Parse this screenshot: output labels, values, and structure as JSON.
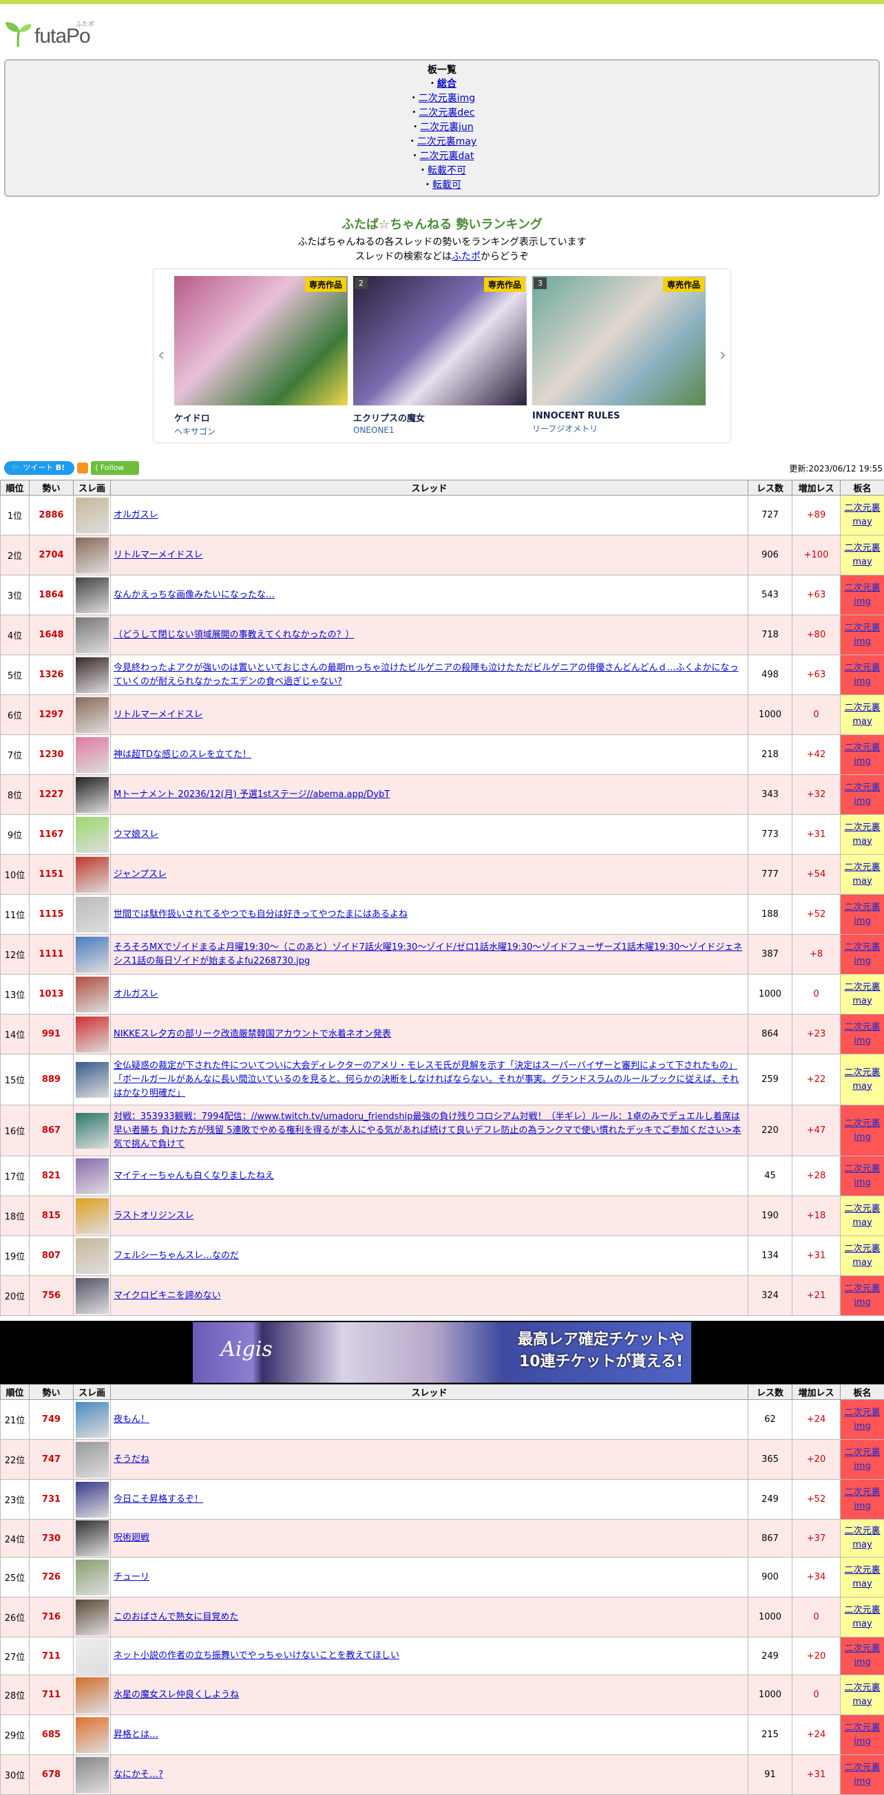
{
  "logo": {
    "text": "futaPo",
    "kana": "ふたポ"
  },
  "boards": {
    "title": "板一覧",
    "items": [
      {
        "label": "総合",
        "bold": true
      },
      {
        "label": "二次元裏img"
      },
      {
        "label": "二次元裏dec"
      },
      {
        "label": "二次元裏jun"
      },
      {
        "label": "二次元裏may"
      },
      {
        "label": "二次元裏dat"
      },
      {
        "label": "転載不可"
      },
      {
        "label": "転載可"
      }
    ]
  },
  "ranking": {
    "title": "ふたば☆ちゃんねる 勢いランキング",
    "desc1": "ふたばちゃんねるの各スレッドの勢いをランキング表示しています",
    "desc2_pre": "スレッドの検索などは",
    "desc2_link": "ふたポ",
    "desc2_post": "からどうぞ"
  },
  "carousel": {
    "items": [
      {
        "name": "ケイドロ",
        "maker": "ヘキサゴン",
        "badge": "専売作品",
        "num": "",
        "c1": "#b85c88",
        "c2": "#3b7a3a"
      },
      {
        "name": "エクリプスの魔女",
        "maker": "ONEONE1",
        "badge": "専売作品",
        "num": "2",
        "c1": "#2a1f3a",
        "c2": "#7a6cb0"
      },
      {
        "name": "INNOCENT RULES",
        "maker": "リーフジオメトリ",
        "badge": "専売作品",
        "num": "3",
        "c1": "#6aa89a",
        "c2": "#e0d7cf"
      }
    ]
  },
  "social": {
    "tweet": "ツイート",
    "hatena": "B!",
    "follow": "Follow"
  },
  "updated": "更新:2023/06/12 19:55",
  "table": {
    "headers": {
      "rank": "順位",
      "ikioi": "勢い",
      "thumb": "スレ画",
      "thread": "スレッド",
      "res": "レス数",
      "inc": "増加レス",
      "board": "板名"
    }
  },
  "rows1": [
    {
      "rank": "1位",
      "ikioi": "2886",
      "title": "オルガスレ",
      "res": "727",
      "inc": "+89",
      "board": "二次元裏may",
      "type": "may",
      "h": 58,
      "c": "#c8b89a"
    },
    {
      "rank": "2位",
      "ikioi": "2704",
      "title": "リトルマーメイドスレ",
      "res": "906",
      "inc": "+100",
      "board": "二次元裏may",
      "type": "may",
      "h": 58,
      "c": "#8a6a5a"
    },
    {
      "rank": "3位",
      "ikioi": "1864",
      "title": "なんかえっちな画像みたいになったな…",
      "res": "543",
      "inc": "+63",
      "board": "二次元裏img",
      "type": "img",
      "h": 58,
      "c": "#444"
    },
    {
      "rank": "4位",
      "ikioi": "1648",
      "title": "（どうして閉じない領域展開の事教えてくれなかったの？）",
      "res": "718",
      "inc": "+80",
      "board": "二次元裏img",
      "type": "img",
      "h": 58,
      "c": "#777"
    },
    {
      "rank": "5位",
      "ikioi": "1326",
      "title": "今見終わったよアクが強いのは置いといておじさんの最期mっちゃ泣けたビルゲニアの殺陣も泣けたただビルゲニアの俳優さんどんどんｄ…ふくよかになっていくのが耐えられなかったエデンの食べ過ぎじゃない?",
      "res": "498",
      "inc": "+63",
      "board": "二次元裏img",
      "type": "img",
      "h": 58,
      "c": "#3a2a2a"
    },
    {
      "rank": "6位",
      "ikioi": "1297",
      "title": "リトルマーメイドスレ",
      "res": "1000",
      "inc": "0",
      "board": "二次元裏may",
      "type": "may",
      "h": 58,
      "c": "#8a6a5a"
    },
    {
      "rank": "7位",
      "ikioi": "1230",
      "title": "神は超TDな感じのスレを立てた！",
      "res": "218",
      "inc": "+42",
      "board": "二次元裏img",
      "type": "img",
      "h": 58,
      "c": "#e07aa0"
    },
    {
      "rank": "8位",
      "ikioi": "1227",
      "title": "Mトーナメント 20236/12(月) 予選1stステージ//abema.app/DybT",
      "res": "343",
      "inc": "+32",
      "board": "二次元裏img",
      "type": "img",
      "h": 58,
      "c": "#222"
    },
    {
      "rank": "9位",
      "ikioi": "1167",
      "title": "ウマ娘スレ",
      "res": "773",
      "inc": "+31",
      "board": "二次元裏may",
      "type": "may",
      "h": 58,
      "c": "#9ad86a"
    },
    {
      "rank": "10位",
      "ikioi": "1151",
      "title": "ジャンプスレ",
      "res": "777",
      "inc": "+54",
      "board": "二次元裏may",
      "type": "may",
      "h": 58,
      "c": "#c0392b"
    },
    {
      "rank": "11位",
      "ikioi": "1115",
      "title": "世間では駄作扱いされてるやつでも自分は好きってやつたまにはあるよね",
      "res": "188",
      "inc": "+52",
      "board": "二次元裏img",
      "type": "img",
      "h": 58,
      "c": "#bbb"
    },
    {
      "rank": "12位",
      "ikioi": "1111",
      "title": "そろそろMXでゾイドまるよ月曜19:30～（このあと）ゾイド7話火曜19:30～ゾイド/ゼロ1話水曜19:30～ゾイドフューザーズ1話木曜19:30～ゾイドジェネシス1話の毎日ゾイドが始まるよfu2268730.jpg",
      "res": "387",
      "inc": "+8",
      "board": "二次元裏img",
      "type": "img",
      "h": 58,
      "c": "#4a7ac0"
    },
    {
      "rank": "13位",
      "ikioi": "1013",
      "title": "オルガスレ",
      "res": "1000",
      "inc": "0",
      "board": "二次元裏may",
      "type": "may",
      "h": 58,
      "c": "#b05040"
    },
    {
      "rank": "14位",
      "ikioi": "991",
      "title": "NIKKEスレ夕方の部リーク改造厳禁韓国アカウントで水着ネオン発表",
      "res": "864",
      "inc": "+23",
      "board": "二次元裏img",
      "type": "img",
      "h": 58,
      "c": "#d03030"
    },
    {
      "rank": "15位",
      "ikioi": "889",
      "title": "全仏疑惑の裁定が下された件についてついに大会ディレクターのアメリ・モレスモ氏が見解を示す「決定はスーパーバイザーと審判によって下されたもの」「ボールガールがあんなに長い間泣いているのを見ると、何らかの決断をしなければならない。それが事実。グランドスラムのルールブックに従えば、それはかなり明確だ」",
      "res": "259",
      "inc": "+22",
      "board": "二次元裏may",
      "type": "may",
      "h": 74,
      "c": "#3a5a8a"
    },
    {
      "rank": "16位",
      "ikioi": "867",
      "title": "対戦：353933観戦：7994配信：//www.twitch.tv/umadoru_friendship最強の負け残りコロシアム対戦！（半ギレ）ルール：1卓のみでデュエルし着席は早い者勝ち 負けた方が残留 5連敗でやめる権利を得るが本人にやる気があれば続けて良いデフレ防止の為ランクマで使い慣れたデッキでご参加ください>本気で挑んで負けて",
      "res": "220",
      "inc": "+47",
      "board": "二次元裏img",
      "type": "img",
      "h": 74,
      "c": "#2a7a6a"
    },
    {
      "rank": "17位",
      "ikioi": "821",
      "title": "マイティーちゃんも白くなりましたねえ",
      "res": "45",
      "inc": "+28",
      "board": "二次元裏img",
      "type": "img",
      "h": 58,
      "c": "#8a6ab0"
    },
    {
      "rank": "18位",
      "ikioi": "815",
      "title": "ラストオリジンスレ",
      "res": "190",
      "inc": "+18",
      "board": "二次元裏may",
      "type": "may",
      "h": 58,
      "c": "#e0a020"
    },
    {
      "rank": "19位",
      "ikioi": "807",
      "title": "フェルシーちゃんスレ…なのだ",
      "res": "134",
      "inc": "+31",
      "board": "二次元裏may",
      "type": "may",
      "h": 58,
      "c": "#c8b89a"
    },
    {
      "rank": "20位",
      "ikioi": "756",
      "title": "マイクロビキニを諦めない",
      "res": "324",
      "inc": "+21",
      "board": "二次元裏img",
      "type": "img",
      "h": 58,
      "c": "#556"
    }
  ],
  "ad": {
    "logo": "Aigis",
    "line1": "最高レア確定チケットや",
    "line2": "10連チケットが貰える!"
  },
  "rows2": [
    {
      "rank": "21位",
      "ikioi": "749",
      "title": "夜もん！",
      "res": "62",
      "inc": "+24",
      "board": "二次元裏img",
      "type": "img",
      "h": 58,
      "c": "#4a8ac0"
    },
    {
      "rank": "22位",
      "ikioi": "747",
      "title": "そうだね",
      "res": "365",
      "inc": "+20",
      "board": "二次元裏img",
      "type": "img",
      "h": 58,
      "c": "#999"
    },
    {
      "rank": "23位",
      "ikioi": "731",
      "title": "今日こそ昇格するぞ！",
      "res": "249",
      "inc": "+52",
      "board": "二次元裏img",
      "type": "img",
      "h": 58,
      "c": "#3a3a8a"
    },
    {
      "rank": "24位",
      "ikioi": "730",
      "title": "呪術廻戦",
      "res": "867",
      "inc": "+37",
      "board": "二次元裏may",
      "type": "may",
      "h": 54,
      "c": "#333"
    },
    {
      "rank": "25位",
      "ikioi": "726",
      "title": "チューリ",
      "res": "900",
      "inc": "+34",
      "board": "二次元裏may",
      "type": "may",
      "h": 58,
      "c": "#8aa070"
    },
    {
      "rank": "26位",
      "ikioi": "716",
      "title": "このおばさんで熟女に目覚めた",
      "res": "1000",
      "inc": "0",
      "board": "二次元裏may",
      "type": "may",
      "h": 58,
      "c": "#5a4a3a"
    },
    {
      "rank": "27位",
      "ikioi": "711",
      "title": "ネット小説の作者の立ち振舞いでやっちゃいけないことを教えてほしい",
      "res": "249",
      "inc": "+20",
      "board": "二次元裏img",
      "type": "img",
      "h": 48,
      "c": "#eee"
    },
    {
      "rank": "28位",
      "ikioi": "711",
      "title": "水星の魔女スレ仲良くしようね",
      "res": "1000",
      "inc": "0",
      "board": "二次元裏may",
      "type": "may",
      "h": 58,
      "c": "#d07030"
    },
    {
      "rank": "29位",
      "ikioi": "685",
      "title": "昇格とは…",
      "res": "215",
      "inc": "+24",
      "board": "二次元裏img",
      "type": "img",
      "h": 58,
      "c": "#e07030"
    },
    {
      "rank": "30位",
      "ikioi": "678",
      "title": "なにかそ…?",
      "res": "91",
      "inc": "+31",
      "board": "二次元裏img",
      "type": "img",
      "h": 58,
      "c": "#888"
    }
  ]
}
